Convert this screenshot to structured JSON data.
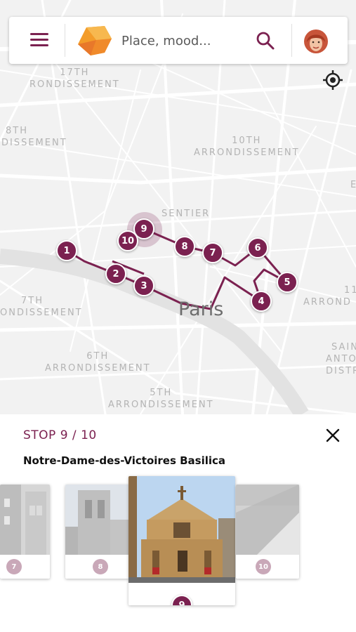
{
  "search": {
    "placeholder": "Place, mood..."
  },
  "map": {
    "districts": [
      {
        "line1": "17TH",
        "line2": "RONDISSEMENT"
      },
      {
        "line1": "8TH",
        "line2": "DISSEMENT"
      },
      {
        "line1": "10TH",
        "line2": "ARRONDISSEMENT"
      },
      {
        "line1": "SENTIER",
        "line2": ""
      },
      {
        "line1": "7TH",
        "line2": "ONDISSEMENT"
      },
      {
        "line1": "6TH",
        "line2": "ARRONDISSEMENT"
      },
      {
        "line1": "5TH",
        "line2": "ARRONDISSEMENT"
      },
      {
        "line1": "11",
        "line2": "ARROND"
      },
      {
        "line1": "SAIN",
        "line2": "ANTO",
        "line3": "DISTR"
      },
      {
        "line1": "E",
        "line2": ""
      }
    ],
    "city_label": "Paris",
    "stops": [
      "1",
      "2",
      "3",
      "4",
      "5",
      "6",
      "7",
      "8",
      "9",
      "10"
    ]
  },
  "panel": {
    "stop_counter": "STOP 9 / 10",
    "place_name": "Notre-Dame-des-Victoires Basilica",
    "cards": [
      {
        "number": "7"
      },
      {
        "number": "8"
      },
      {
        "number": "9"
      },
      {
        "number": "10"
      }
    ]
  },
  "colors": {
    "accent": "#7b2150",
    "inactive_badge": "#c9a8b8",
    "map_bg": "#f2f2f2"
  },
  "icons": [
    "menu-icon",
    "logo",
    "search-icon",
    "avatar",
    "locate-icon",
    "close-icon"
  ]
}
